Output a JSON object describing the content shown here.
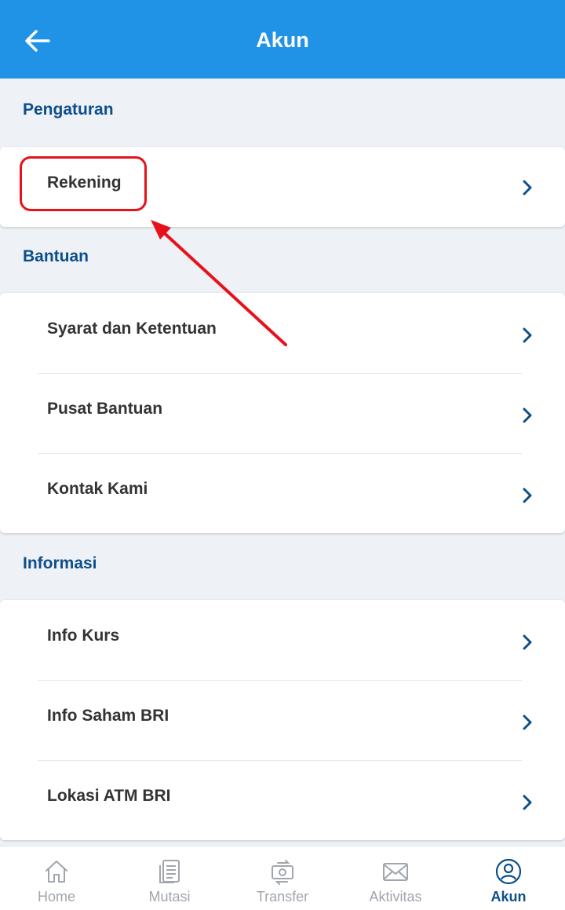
{
  "header": {
    "title": "Akun"
  },
  "sections": [
    {
      "title": "Pengaturan",
      "items": [
        {
          "label": "Rekening"
        }
      ]
    },
    {
      "title": "Bantuan",
      "items": [
        {
          "label": "Syarat dan Ketentuan"
        },
        {
          "label": "Pusat Bantuan"
        },
        {
          "label": "Kontak Kami"
        }
      ]
    },
    {
      "title": "Informasi",
      "items": [
        {
          "label": "Info Kurs"
        },
        {
          "label": "Info Saham BRI"
        },
        {
          "label": "Lokasi ATM BRI"
        }
      ]
    }
  ],
  "bottom_nav": {
    "items": [
      {
        "label": "Home",
        "icon": "home-icon"
      },
      {
        "label": "Mutasi",
        "icon": "document-icon"
      },
      {
        "label": "Transfer",
        "icon": "transfer-icon"
      },
      {
        "label": "Aktivitas",
        "icon": "mail-icon"
      },
      {
        "label": "Akun",
        "icon": "user-circle-icon"
      }
    ],
    "active": "Akun"
  },
  "colors": {
    "primary": "#2193e6",
    "section_title": "#0d4f8a",
    "annotation": "#e8111b",
    "background": "#eef1f6"
  }
}
